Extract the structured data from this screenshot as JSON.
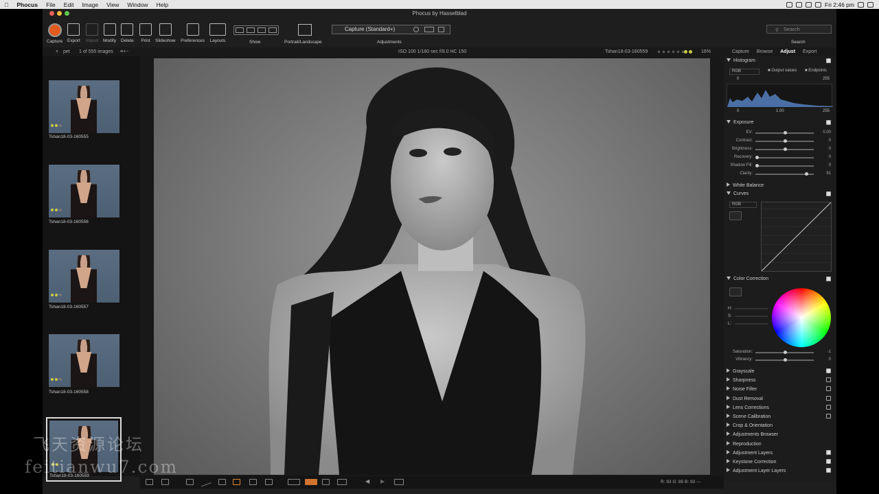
{
  "menubar": {
    "app": "Phocus",
    "items": [
      "File",
      "Edit",
      "Image",
      "View",
      "Window",
      "Help"
    ],
    "clock": "Fri 2:46 pm"
  },
  "window": {
    "title": "Phocus by Hasselblad"
  },
  "toolbar": {
    "buttons": [
      "Capture",
      "Export",
      "Import",
      "Modify",
      "Delete",
      "Print",
      "Slideshow",
      "Preferences",
      "Layouts"
    ],
    "show_label": "Show",
    "portrait_label": "Portrait/Landscape",
    "adjustments_label": "Adjustments",
    "adjustments_value": "Capture (Standard+)",
    "search_placeholder": "Search",
    "search_label": "Search"
  },
  "infobar": {
    "folder": "pet",
    "count": "1 of 555 images",
    "exif": "ISO 100  1/160 sec  f/8.0  HC 150",
    "filename": "Tshan18-03-160559",
    "zoom": "16%"
  },
  "right_tabs": [
    "Capture",
    "Browse",
    "Adjust",
    "Export"
  ],
  "active_tab": "Adjust",
  "thumbnails": [
    {
      "label": "Tshan18-03-160555"
    },
    {
      "label": "Tshan18-03-160556"
    },
    {
      "label": "Tshan18-03-160557"
    },
    {
      "label": "Tshan18-03-160558"
    },
    {
      "label": "Tshan18-03-160559"
    }
  ],
  "histogram": {
    "title": "Histogram",
    "channel": "RGB",
    "output_values": "Output values",
    "endpoints": "Endpoints",
    "in_min": "0",
    "in_max": "255",
    "out_min": "0",
    "gamma": "1.00",
    "out_max": "255"
  },
  "exposure": {
    "title": "Exposure",
    "sliders": [
      {
        "label": "EV:",
        "value": "0.00",
        "pos": 0.5
      },
      {
        "label": "Contrast:",
        "value": "0",
        "pos": 0.5
      },
      {
        "label": "Brightness:",
        "value": "0",
        "pos": 0.5
      },
      {
        "label": "Recovery:",
        "value": "0",
        "pos": 0.0
      },
      {
        "label": "Shadow Fill:",
        "value": "0",
        "pos": 0.0
      },
      {
        "label": "Clarity:",
        "value": "91",
        "pos": 0.88
      }
    ]
  },
  "white_balance": {
    "title": "White Balance"
  },
  "curves": {
    "title": "Curves",
    "channel": "RGB"
  },
  "color_correction": {
    "title": "Color Correction",
    "hsl": [
      "H:",
      "S:",
      "L:"
    ],
    "saturation": {
      "label": "Saturation:",
      "value": "-1",
      "pos": 0.5
    },
    "vibrancy": {
      "label": "Vibrancy:",
      "value": "0",
      "pos": 0.5
    }
  },
  "tools": [
    "Grayscale",
    "Sharpness",
    "Noise Filter",
    "Dust Removal",
    "Lens Corrections",
    "Scene Calibration",
    "Crop & Orientation",
    "Adjustments Browser",
    "Reproduction",
    "Adjustment Layers",
    "Keystone Correction",
    "Adjustment Layer Layers"
  ],
  "pixel_readout": "R: 93  G: 85  B: 93  ---",
  "watermark": {
    "line1": "飞天资源论坛",
    "line2": "feitianwu7.com"
  }
}
